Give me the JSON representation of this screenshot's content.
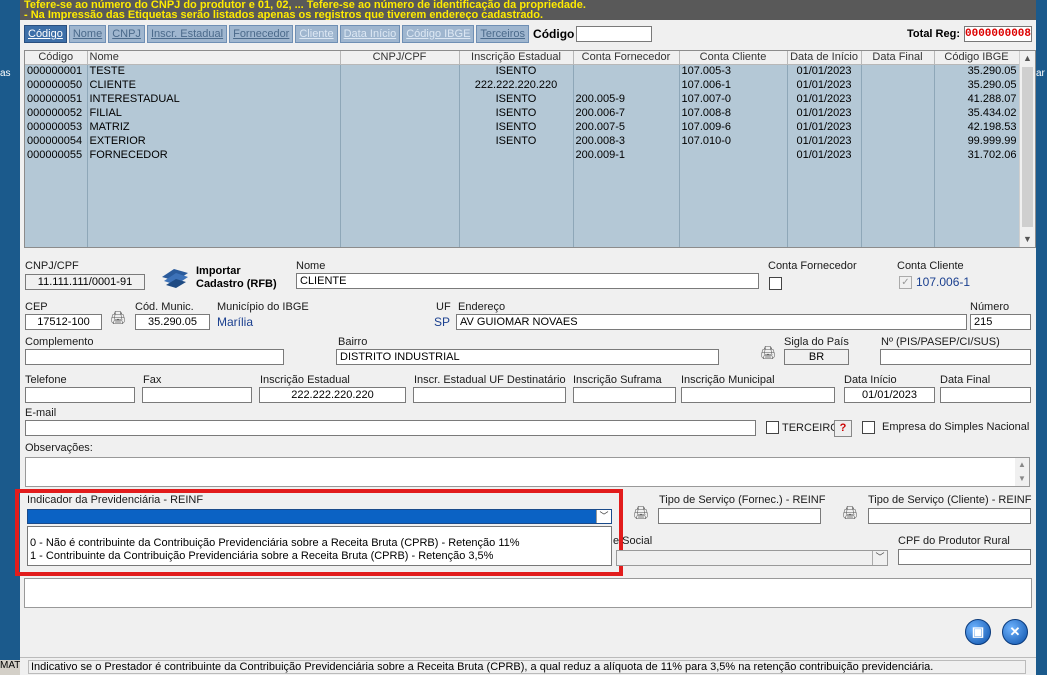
{
  "left_strip_text": "as",
  "right_strip_text": "ar",
  "bottom_left_text": "MAT",
  "banner": {
    "line1": "Tefere-se ao número do CNPJ do produtor e 01, 02, ... Tefere-se ao número de identificação da propriedade.",
    "line2": "- Na Impressão das Etiquetas serão listados apenas os registros que tiverem endereço cadastrado."
  },
  "tabs": [
    {
      "label": "Código",
      "active": true
    },
    {
      "label": "Nome"
    },
    {
      "label": "CNPJ"
    },
    {
      "label": "Inscr. Estadual"
    },
    {
      "label": "Fornecedor"
    },
    {
      "label": "Cliente"
    },
    {
      "label": "Data Início"
    },
    {
      "label": "Código IBGE"
    },
    {
      "label": "Terceiros"
    }
  ],
  "search": {
    "label": "Código",
    "value": ""
  },
  "total": {
    "label": "Total Reg:",
    "value": "0000000008"
  },
  "grid": {
    "columns": [
      "Código",
      "Nome",
      "CNPJ/CPF",
      "Inscrição Estadual",
      "Conta Fornecedor",
      "Conta Cliente",
      "Data de Início",
      "Data Final",
      "Código IBGE"
    ],
    "rows": [
      [
        "000000001",
        "TESTE",
        "",
        "ISENTO",
        "",
        "107.005-3",
        "01/01/2023",
        "",
        "35.290.05"
      ],
      [
        "000000050",
        "CLIENTE",
        "",
        "222.222.220.220",
        "",
        "107.006-1",
        "01/01/2023",
        "",
        "35.290.05"
      ],
      [
        "000000051",
        "INTERESTADUAL",
        "",
        "ISENTO",
        "200.005-9",
        "107.007-0",
        "01/01/2023",
        "",
        "41.288.07"
      ],
      [
        "000000052",
        "FILIAL",
        "",
        "ISENTO",
        "200.006-7",
        "107.008-8",
        "01/01/2023",
        "",
        "35.434.02"
      ],
      [
        "000000053",
        "MATRIZ",
        "",
        "ISENTO",
        "200.007-5",
        "107.009-6",
        "01/01/2023",
        "",
        "42.198.53"
      ],
      [
        "000000054",
        "EXTERIOR",
        "",
        "ISENTO",
        "200.008-3",
        "107.010-0",
        "01/01/2023",
        "",
        "99.999.99"
      ],
      [
        "000000055",
        "FORNECEDOR",
        "",
        "",
        "200.009-1",
        "",
        "01/01/2023",
        "",
        "31.702.06"
      ]
    ]
  },
  "form": {
    "cnpj_label": "CNPJ/CPF",
    "cnpj_value": "11.111.111/0001-91",
    "rfb_line1": "Importar",
    "rfb_line2": "Cadastro (RFB)",
    "nome_label": "Nome",
    "nome_value": "CLIENTE",
    "conta_fornecedor_label": "Conta Fornecedor",
    "conta_cliente_label": "Conta Cliente",
    "conta_cliente_value": "107.006-1",
    "cep_label": "CEP",
    "cep_value": "17512-100",
    "cod_munic_label": "Cód. Munic.",
    "cod_munic_value": "35.290.05",
    "municipio_label": "Município do IBGE",
    "municipio_value": "Marília",
    "uf_label": "UF",
    "uf_value": "SP",
    "endereco_label": "Endereço",
    "endereco_value": "AV GUIOMAR NOVAES",
    "numero_label": "Número",
    "numero_value": "215",
    "complemento_label": "Complemento",
    "bairro_label": "Bairro",
    "bairro_value": "DISTRITO INDUSTRIAL",
    "sigla_pais_label": "Sigla do País",
    "sigla_pais_value": "BR",
    "nif_label": "Nº (PIS/PASEP/CI/SUS)",
    "telefone_label": "Telefone",
    "fax_label": "Fax",
    "ie_label": "Inscrição Estadual",
    "ie_value": "222.222.220.220",
    "ie_uf_dest_label": "Inscr. Estadual UF Destinatário",
    "suframa_label": "Inscrição Suframa",
    "im_label": "Inscrição Municipal",
    "data_inicio_label": "Data Início",
    "data_inicio_value": "01/01/2023",
    "data_final_label": "Data Final",
    "email_label": "E-mail",
    "terceiro_label": "TERCEIRO",
    "help_label": "?",
    "simples_label": "Empresa do Simples Nacional",
    "observacoes_label": "Observações:",
    "reinf_label": "Indicador da Previdenciária - REINF",
    "reinf_options": [
      "0 - Não é contribuinte da Contribuição Previdenciária sobre a Receita Bruta (CPRB) - Retenção 11%",
      "1 - Contribuinte da Contribuição Previdenciária sobre a Receita Bruta (CPRB) - Retenção 3,5%"
    ],
    "tipo_servico_fornec_label": "Tipo de Serviço (Fornec.) - REINF",
    "tipo_servico_cliente_label": "Tipo de Serviço (Cliente) - REINF",
    "social_label": "e Social",
    "cpf_produtor_label": "CPF do Produtor Rural"
  },
  "status_text": "Indicativo se o Prestador é contribuinte da Contribuição Previdenciária sobre a Receita Bruta (CPRB), a qual reduz a alíquota de 11% para 3,5% na retenção contribuição previdenciária."
}
